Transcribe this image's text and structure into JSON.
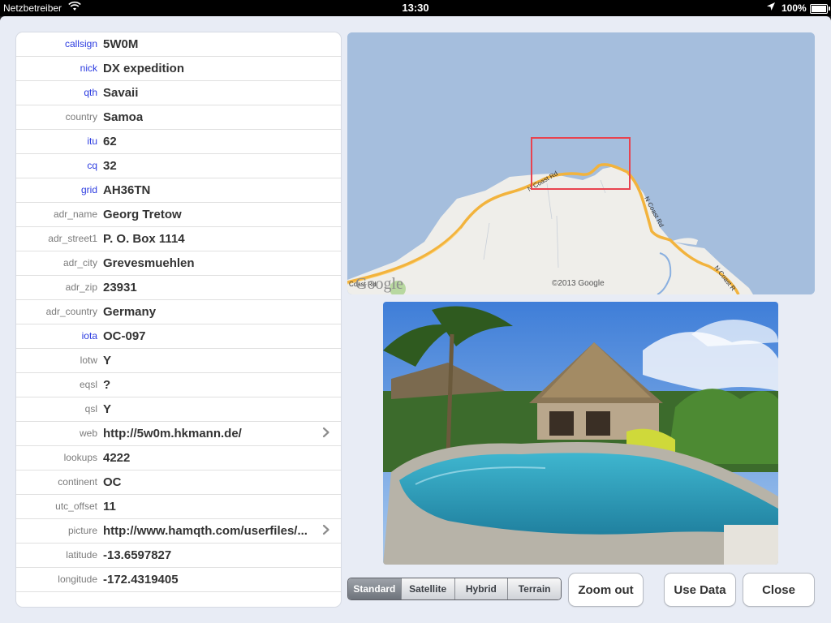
{
  "status_bar": {
    "carrier": "Netzbetreiber",
    "time": "13:30",
    "battery": "100%"
  },
  "fields": [
    {
      "key": "callsign",
      "value": "5W0M",
      "highlight": true
    },
    {
      "key": "nick",
      "value": "DX expedition",
      "highlight": true
    },
    {
      "key": "qth",
      "value": "Savaii",
      "highlight": true
    },
    {
      "key": "country",
      "value": "Samoa",
      "highlight": false
    },
    {
      "key": "itu",
      "value": "62",
      "highlight": true
    },
    {
      "key": "cq",
      "value": "32",
      "highlight": true
    },
    {
      "key": "grid",
      "value": "AH36TN",
      "highlight": true
    },
    {
      "key": "adr_name",
      "value": "Georg Tretow",
      "highlight": false
    },
    {
      "key": "adr_street1",
      "value": "P. O. Box 1114",
      "highlight": false
    },
    {
      "key": "adr_city",
      "value": "Grevesmuehlen",
      "highlight": false
    },
    {
      "key": "adr_zip",
      "value": "23931",
      "highlight": false
    },
    {
      "key": "adr_country",
      "value": "Germany",
      "highlight": false
    },
    {
      "key": "iota",
      "value": "OC-097",
      "highlight": true
    },
    {
      "key": "lotw",
      "value": "Y",
      "highlight": false
    },
    {
      "key": "eqsl",
      "value": "?",
      "highlight": false
    },
    {
      "key": "qsl",
      "value": "Y",
      "highlight": false
    },
    {
      "key": "web",
      "value": "http://5w0m.hkmann.de/",
      "highlight": false,
      "link": true
    },
    {
      "key": "lookups",
      "value": "4222",
      "highlight": false
    },
    {
      "key": "continent",
      "value": "OC",
      "highlight": false
    },
    {
      "key": "utc_offset",
      "value": "11",
      "highlight": false
    },
    {
      "key": "picture",
      "value": "http://www.hamqth.com/userfiles/...",
      "highlight": false,
      "link": true
    },
    {
      "key": "latitude",
      "value": "-13.6597827",
      "highlight": false
    },
    {
      "key": "longitude",
      "value": "-172.4319405",
      "highlight": false
    }
  ],
  "map": {
    "logo": "Google",
    "copyright": "©2013 Google",
    "road_labels": [
      "N Coast Rd",
      "N Coast Rd",
      "N Coast R",
      "Coast Rd"
    ]
  },
  "map_types": {
    "options": [
      "Standard",
      "Satellite",
      "Hybrid",
      "Terrain"
    ],
    "selected": "Standard"
  },
  "buttons": {
    "zoom_out": "Zoom out",
    "use_data": "Use Data",
    "close": "Close"
  },
  "colors": {
    "key_highlight": "#2b3be0",
    "key_normal": "#7b7b7b",
    "ocean": "#a5bedd",
    "land": "#efeeea",
    "road": "#f2b33d",
    "marker": "#e8434f"
  }
}
